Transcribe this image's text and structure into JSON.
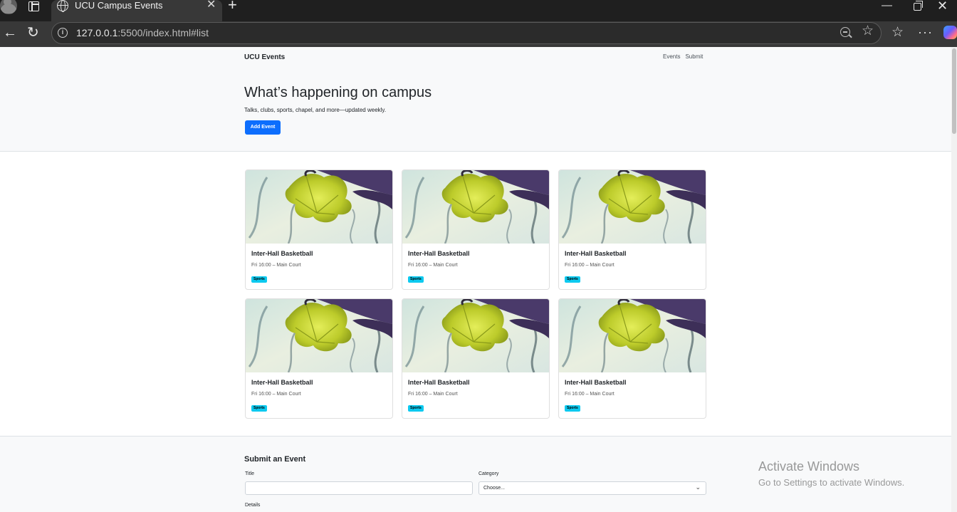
{
  "browser": {
    "tab_title": "UCU Campus Events",
    "url_host": "127.0.0.1",
    "url_rest": ":5500/index.html#list",
    "icons": [
      "profile-icon",
      "tabs-icon",
      "globe-icon",
      "close-icon",
      "new-tab-icon",
      "back-icon",
      "reload-icon",
      "info-icon",
      "zoom-out-icon",
      "star-icon",
      "favorites-icon",
      "more-icon",
      "copilot-icon"
    ]
  },
  "nav": {
    "brand": "UCU Events",
    "links": [
      "Events",
      "Submit"
    ]
  },
  "hero": {
    "title": "What’s happening on campus",
    "subtitle": "Talks, clubs, sports, chapel, and more—updated weekly.",
    "button": "Add Event"
  },
  "events": [
    {
      "title": "Inter-Hall Basketball",
      "meta": "Fri 16:00 – Main Court",
      "badge": "Sports"
    },
    {
      "title": "Inter-Hall Basketball",
      "meta": "Fri 16:00 – Main Court",
      "badge": "Sports"
    },
    {
      "title": "Inter-Hall Basketball",
      "meta": "Fri 16:00 – Main Court",
      "badge": "Sports"
    },
    {
      "title": "Inter-Hall Basketball",
      "meta": "Fri 16:00 – Main Court",
      "badge": "Sports"
    },
    {
      "title": "Inter-Hall Basketball",
      "meta": "Fri 16:00 – Main Court",
      "badge": "Sports"
    },
    {
      "title": "Inter-Hall Basketball",
      "meta": "Fri 16:00 – Main Court",
      "badge": "Sports"
    }
  ],
  "form": {
    "title": "Submit an Event",
    "title_label": "Title",
    "category_label": "Category",
    "category_value": "Choose...",
    "details_label": "Details"
  },
  "watermark": {
    "line1": "Activate Windows",
    "line2": "Go to Settings to activate Windows."
  },
  "colors": {
    "primary": "#0d6efd",
    "badge": "#0dcaf0",
    "hero_bg": "#f8f9fa"
  }
}
